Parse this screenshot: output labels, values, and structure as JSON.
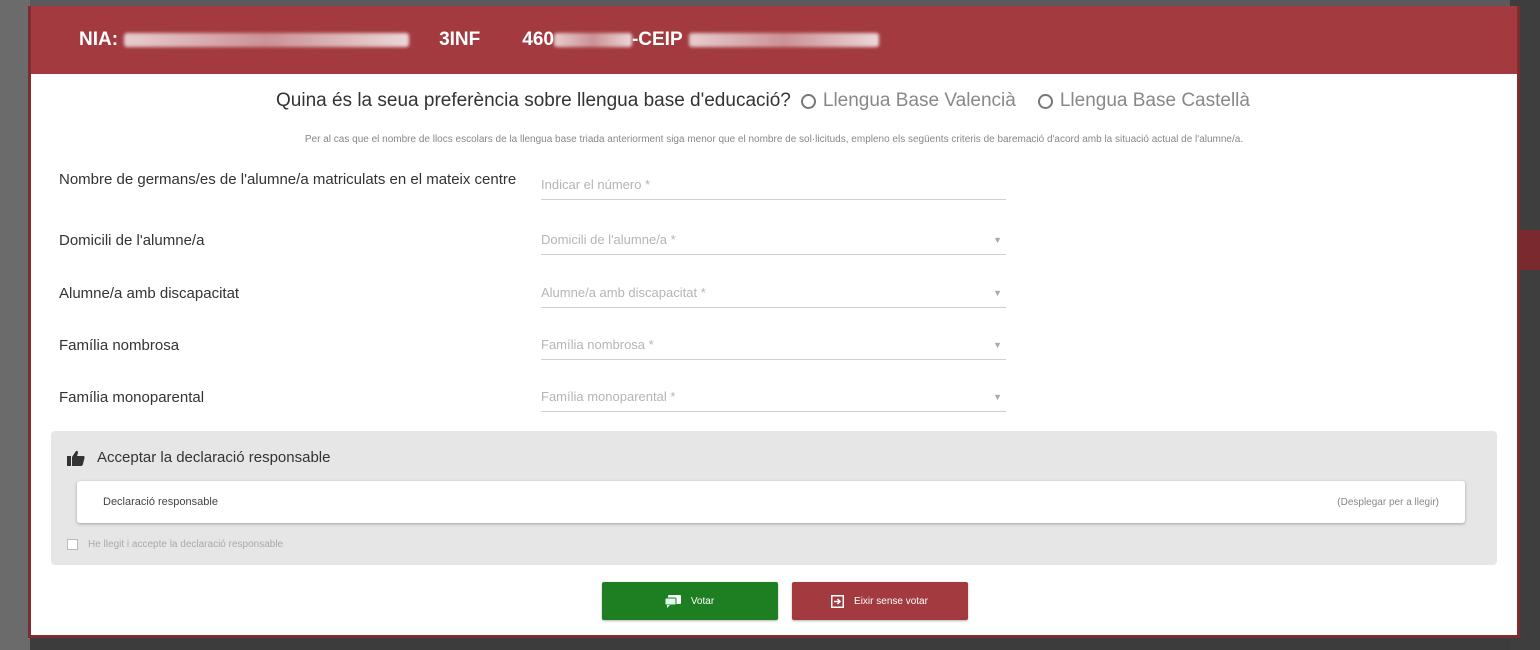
{
  "header": {
    "nia_label": "NIA:",
    "course": "3INF",
    "center_prefix": "460",
    "center_type": "-CEIP"
  },
  "language": {
    "question": "Quina és la seua preferència sobre llengua base d'educació?",
    "options": [
      "Llengua Base Valencià",
      "Llengua Base Castellà"
    ]
  },
  "note": "Per al cas que el nombre de llocs escolars de la llengua base triada anteriorment siga menor que el nombre de sol·licituds, empleno els següents criteris de baremació d'acord amb la situació actual de l'alumne/a.",
  "fields": [
    {
      "label": "Nombre de germans/es de l'alumne/a matriculats en el mateix centre",
      "placeholder": "Indicar el número *",
      "type": "input"
    },
    {
      "label": "Domicili de l'alumne/a",
      "placeholder": "Domicili de l'alumne/a *",
      "type": "select"
    },
    {
      "label": "Alumne/a amb discapacitat",
      "placeholder": "Alumne/a amb discapacitat *",
      "type": "select"
    },
    {
      "label": "Família nombrosa",
      "placeholder": "Família nombrosa *",
      "type": "select"
    },
    {
      "label": "Família monoparental",
      "placeholder": "Família monoparental *",
      "type": "select"
    }
  ],
  "declaration": {
    "title": "Acceptar la declaració responsable",
    "panel_label": "Declaració responsable",
    "expand_hint": "(Desplegar per a llegir)",
    "checkbox_label": "He llegit i accepte la declaració responsable"
  },
  "actions": {
    "vote": "Votar",
    "exit": "Eixir sense votar"
  },
  "colors": {
    "header": "#a23a3f",
    "vote_button": "#1e7f22",
    "exit_button": "#a23a3f"
  }
}
